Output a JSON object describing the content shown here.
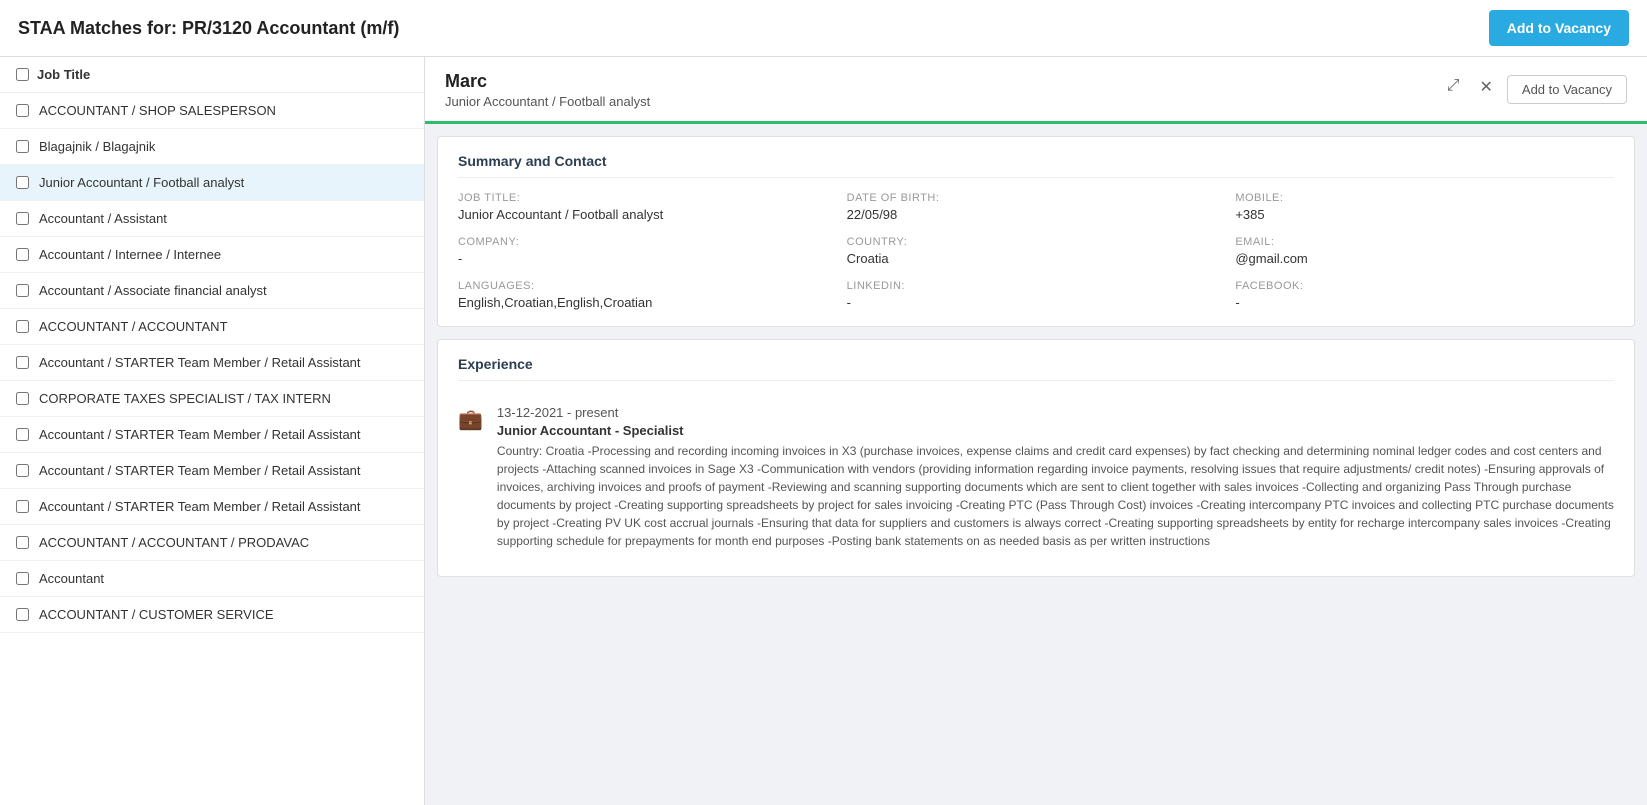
{
  "app": {
    "title": "STAA Matches for: PR/3120 Accountant (m/f)",
    "add_vacancy_top_label": "Add to Vacancy"
  },
  "left_panel": {
    "header_label": "Job Title",
    "items": [
      {
        "id": 1,
        "label": "ACCOUNTANT / SHOP SALESPERSON",
        "checked": false
      },
      {
        "id": 2,
        "label": "Blagajnik / Blagajnik",
        "checked": false
      },
      {
        "id": 3,
        "label": "Junior Accountant / Football analyst",
        "checked": false,
        "active": true
      },
      {
        "id": 4,
        "label": "Accountant / Assistant",
        "checked": false
      },
      {
        "id": 5,
        "label": "Accountant / Internee / Internee",
        "checked": false
      },
      {
        "id": 6,
        "label": "Accountant / Associate financial analyst",
        "checked": false
      },
      {
        "id": 7,
        "label": "ACCOUNTANT / ACCOUNTANT",
        "checked": false
      },
      {
        "id": 8,
        "label": "Accountant / STARTER Team Member / Retail Assistant",
        "checked": false
      },
      {
        "id": 9,
        "label": "CORPORATE TAXES SPECIALIST / TAX INTERN",
        "checked": false
      },
      {
        "id": 10,
        "label": "Accountant / STARTER Team Member / Retail Assistant",
        "checked": false
      },
      {
        "id": 11,
        "label": "Accountant / STARTER Team Member / Retail Assistant",
        "checked": false
      },
      {
        "id": 12,
        "label": "Accountant / STARTER Team Member / Retail Assistant",
        "checked": false
      },
      {
        "id": 13,
        "label": "ACCOUNTANT / ACCOUNTANT / PRODAVAC",
        "checked": false
      },
      {
        "id": 14,
        "label": "Accountant",
        "checked": false
      },
      {
        "id": 15,
        "label": "ACCOUNTANT / CUSTOMER SERVICE",
        "checked": false
      }
    ]
  },
  "candidate": {
    "name": "Marc",
    "subtitle": "Junior Accountant / Football analyst",
    "add_vacancy_label": "Add to Vacancy",
    "summary": {
      "section_title": "Summary and Contact",
      "job_title_label": "JOB TITLE:",
      "job_title_value": "Junior Accountant / Football analyst",
      "dob_label": "DATE OF BIRTH:",
      "dob_value": "22/05/98",
      "mobile_label": "MOBILE:",
      "mobile_value": "+385",
      "company_label": "COMPANY:",
      "company_value": "-",
      "country_label": "COUNTRY:",
      "country_value": "Croatia",
      "email_label": "EMAIL:",
      "email_value": "@gmail.com",
      "languages_label": "LANGUAGES:",
      "languages_value": "English,Croatian,English,Croatian",
      "linkedin_label": "LINKEDIN:",
      "linkedin_value": "-",
      "facebook_label": "FACEBOOK:",
      "facebook_value": "-"
    },
    "experience": {
      "section_title": "Experience",
      "entries": [
        {
          "dates": "13-12-2021 - present",
          "title": "Junior Accountant - Specialist",
          "description": "Country: Croatia -Processing and recording incoming invoices in X3 (purchase invoices, expense claims and credit card expenses) by fact checking and determining nominal ledger codes and cost centers and projects -Attaching scanned invoices in Sage X3 -Communication with vendors (providing information regarding invoice payments, resolving issues that require adjustments/ credit notes) -Ensuring approvals of invoices, archiving invoices and proofs of payment -Reviewing and scanning supporting documents which are sent to client together with sales invoices -Collecting and organizing Pass Through purchase documents by project -Creating supporting spreadsheets by project for sales invoicing -Creating PTC (Pass Through Cost) invoices -Creating intercompany PTC invoices and collecting PTC purchase documents by project -Creating PV UK cost accrual journals -Ensuring that data for suppliers and customers is always correct -Creating supporting spreadsheets by entity for recharge intercompany sales invoices -Creating supporting schedule for prepayments for month end purposes -Posting bank statements on as needed basis as per written instructions"
        }
      ]
    }
  }
}
